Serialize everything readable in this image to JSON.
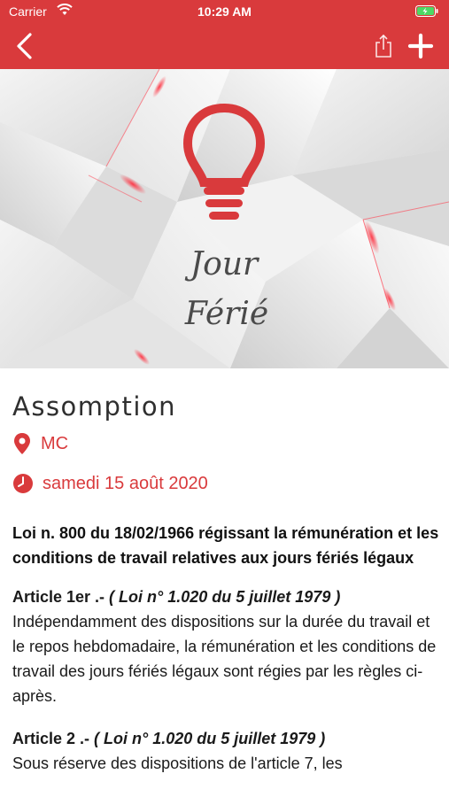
{
  "status_bar": {
    "carrier": "Carrier",
    "time": "10:29 AM"
  },
  "nav": {
    "back_icon": "chevron-left-icon",
    "share_icon": "share-icon",
    "add_icon": "plus-icon"
  },
  "banner": {
    "line1": "Jour",
    "line2": "Férié",
    "icon": "lightbulb-icon"
  },
  "holiday": {
    "name": "Assomption",
    "location": "MC",
    "date": "samedi 15 août 2020"
  },
  "law": {
    "title": "Loi n. 800 du 18/02/1966 régissant la rémunération et les conditions de travail relatives aux jours fériés légaux"
  },
  "articles": [
    {
      "heading": "Article 1er .- ",
      "reference": "( Loi n° 1.020 du 5 juillet 1979 )",
      "text": "Indépendamment des dispositions sur la durée du travail et le repos hebdomadaire, la rémunération et les conditions de travail des jours fériés légaux sont régies par les règles ci-après."
    },
    {
      "heading": "Article 2 .- ",
      "reference": "( Loi n° 1.020 du 5 juillet 1979 )",
      "text": "Sous réserve des dispositions de l'article 7, les"
    }
  ],
  "colors": {
    "accent": "#d93a3c",
    "text": "#1a1a1a"
  }
}
